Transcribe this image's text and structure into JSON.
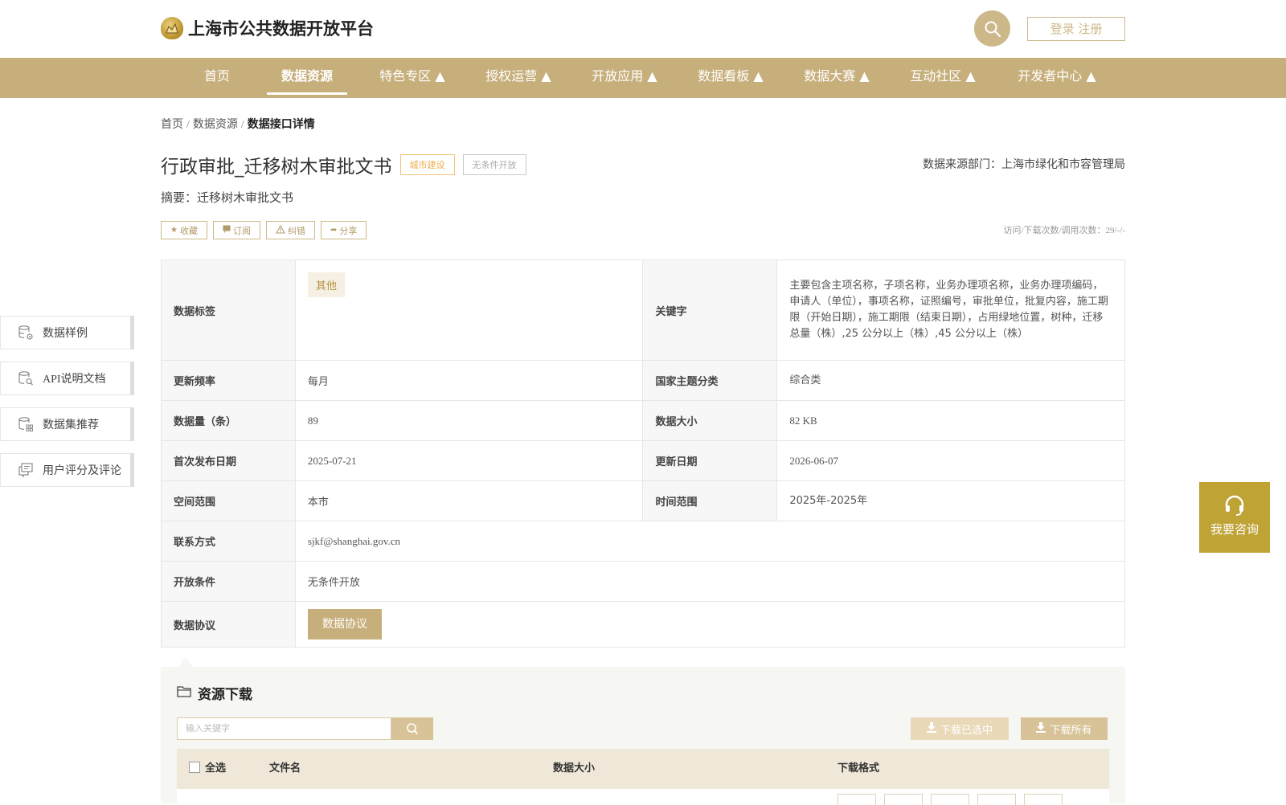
{
  "header": {
    "site_title": "上海市公共数据开放平台",
    "login_label": "登录 注册"
  },
  "nav": {
    "items": [
      {
        "label": "首页"
      },
      {
        "label": "数据资源"
      },
      {
        "label": "特色专区 ▲"
      },
      {
        "label": "授权运营 ▲"
      },
      {
        "label": "开放应用 ▲"
      },
      {
        "label": "数据看板 ▲"
      },
      {
        "label": "数据大赛 ▲"
      },
      {
        "label": "互动社区 ▲"
      },
      {
        "label": "开发者中心 ▲"
      }
    ],
    "active_index": 1
  },
  "breadcrumb": {
    "items": [
      "首页",
      "数据资源"
    ],
    "separator": "/",
    "current": "数据接口详情"
  },
  "dataset": {
    "title": "行政审批_迁移树木审批文书",
    "tag_category": "城市建设",
    "tag_open": "无条件开放",
    "source_dept": "数据来源部门：上海市绿化和市容管理局",
    "summary": "摘要：迁移树木审批文书",
    "counts": "访问/下载次数/调用次数：29/-/-"
  },
  "actions": {
    "favorite": "收藏",
    "subscribe": "订阅",
    "report": "纠错",
    "share": "分享"
  },
  "info": {
    "tags_label": "数据标签",
    "tag_chip": "其他",
    "keywords_label": "关键字",
    "keywords": "主要包含主项名称，子项名称，业务办理项名称，业务办理项编码，申请人（单位），事项名称，证照编号，审批单位，批复内容，施工期限（开始日期），施工期限（结束日期），占用绿地位置，树种，迁移总量（株）,25 公分以上（株）,45 公分以上（株）",
    "freq_label": "更新频率",
    "freq": "每月",
    "theme_label": "国家主题分类",
    "theme": "综合类",
    "count_label": "数据量（条）",
    "count": "89",
    "size_label": "数据大小",
    "size": "82 KB",
    "first_pub_label": "首次发布日期",
    "first_pub": "2025-07-21",
    "update_label": "更新日期",
    "update": "2026-06-07",
    "space_label": "空间范围",
    "space": "本市",
    "time_label": "时间范围",
    "time": "2025年-2025年",
    "contact_label": "联系方式",
    "contact": "sjkf@shanghai.gov.cn",
    "open_cond_label": "开放条件",
    "open_cond": "无条件开放",
    "agreement_label": "数据协议",
    "agreement_btn": "数据协议"
  },
  "side_menu": {
    "items": [
      {
        "label": "数据样例",
        "icon": "database-gear-icon"
      },
      {
        "label": "API说明文档",
        "icon": "database-search-icon"
      },
      {
        "label": "数据集推荐",
        "icon": "database-grid-icon"
      },
      {
        "label": "用户评分及评论",
        "icon": "comment-icon"
      }
    ]
  },
  "consult": {
    "label": "我要咨询",
    "icon": "headset-icon"
  },
  "download": {
    "title": "资源下载",
    "search_placeholder": "输入关键字",
    "download_selected": "下载已选中",
    "download_all": "下载所有",
    "columns": {
      "select_all": "全选",
      "filename": "文件名",
      "size": "数据大小",
      "format": "下载格式"
    }
  },
  "colors": {
    "brand_gold": "#c7af7c",
    "consult_gold": "#bfa335",
    "tag_orange": "#eeac4e"
  }
}
